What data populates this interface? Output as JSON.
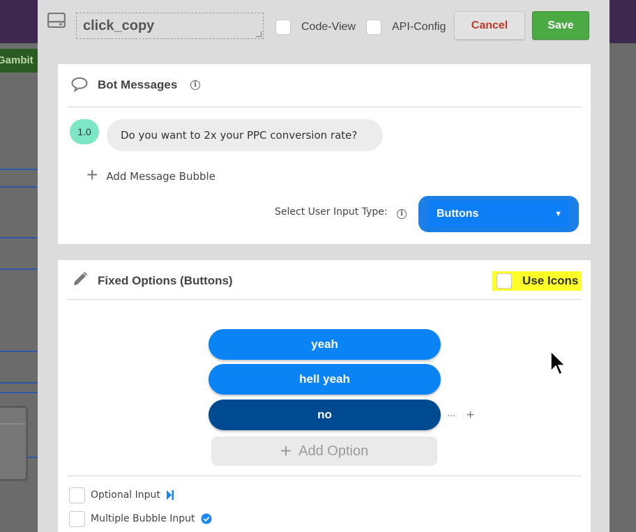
{
  "background": {
    "gambit_label": "Gambit"
  },
  "header": {
    "name_value": "click_copy",
    "code_view_label": "Code-View",
    "api_config_label": "API-Config",
    "cancel_label": "Cancel",
    "save_label": "Save"
  },
  "bot_messages": {
    "title": "Bot Messages",
    "messages": [
      {
        "number": "1.0",
        "text": "Do you want to 2x your PPC conversion rate?"
      }
    ],
    "add_message_label": "Add Message Bubble",
    "input_type_label": "Select User Input Type:",
    "input_type_value": "Buttons"
  },
  "fixed_options": {
    "title": "Fixed Options (Buttons)",
    "use_icons_label": "Use Icons",
    "options": [
      {
        "label": "yeah",
        "selected": false
      },
      {
        "label": "hell yeah",
        "selected": false
      },
      {
        "label": "no",
        "selected": true
      }
    ],
    "more_glyph": "···",
    "plus_glyph": "+",
    "add_option_label": "Add Option",
    "optional_input_label": "Optional Input",
    "multiple_bubble_label": "Multiple Bubble Input"
  },
  "colors": {
    "accent_blue": "#0a84f4",
    "selected_blue": "#004a91",
    "save_green": "#4caa45",
    "cancel_red": "#c0392b",
    "highlight_yellow": "#fdfd2a",
    "message_number_teal": "#7de6c5"
  }
}
